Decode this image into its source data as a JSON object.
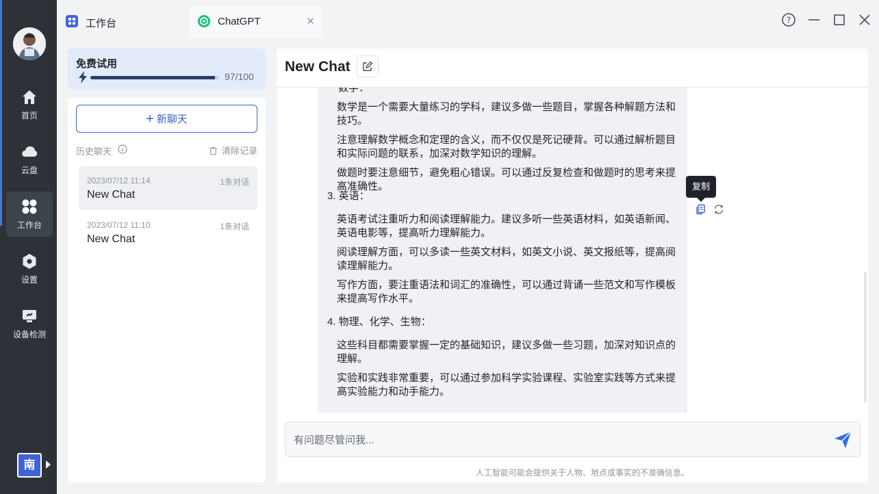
{
  "rail": {
    "items": [
      {
        "label": "首页",
        "icon": "home-icon"
      },
      {
        "label": "云盘",
        "icon": "cloud-icon"
      },
      {
        "label": "工作台",
        "icon": "workbench-icon"
      },
      {
        "label": "设置",
        "icon": "settings-icon"
      },
      {
        "label": "设备检测",
        "icon": "device-check-icon"
      }
    ],
    "lang": "南"
  },
  "tabs": [
    {
      "label": "工作台"
    },
    {
      "label": "ChatGPT"
    }
  ],
  "trial": {
    "title": "免费试用",
    "count": "97/100",
    "progress": 0.97
  },
  "sidebar": {
    "new_chat": "新聊天",
    "history_label": "历史聊天",
    "clear_label": "清除记录",
    "items": [
      {
        "date": "2023/07/12 11:14",
        "count": "1条对话",
        "title": "New Chat"
      },
      {
        "date": "2023/07/12 11:10",
        "count": "1条对话",
        "title": "New Chat"
      }
    ]
  },
  "main": {
    "title": "New Chat",
    "clipped_text": "数学：",
    "paragraphs": [
      "数学是一个需要大量练习的学科，建议多做一些题目，掌握各种解题方法和技巧。",
      "注意理解数学概念和定理的含义，而不仅仅是死记硬背。可以通过解析题目和实际问题的联系，加深对数学知识的理解。",
      "做题时要注意细节，避免粗心错误。可以通过反复检查和做题时的思考来提高准确性。",
      "3. 英语：",
      "英语考试注重听力和阅读理解能力。建议多听一些英语材料，如英语新闻、英语电影等，提高听力理解能力。",
      "阅读理解方面，可以多读一些英文材料，如英文小说、英文报纸等，提高阅读理解能力。",
      "写作方面，要注重语法和词汇的准确性，可以通过背诵一些范文和写作模板来提高写作水平。",
      "4. 物理、化学、生物：",
      "这些科目都需要掌握一定的基础知识，建议多做一些习题，加深对知识点的理解。",
      "实验和实践非常重要，可以通过参加科学实验课程、实验室实践等方式来提高实验能力和动手能力。"
    ],
    "tooltip": "复制",
    "input_placeholder": "有问题尽管问我...",
    "disclaimer": "人工智能可能会提供关于人物、地点或事实的不准确信息。"
  },
  "colors": {
    "accent": "#3b63c7",
    "rail": "#2e3238",
    "send": "#2f6fe0"
  }
}
